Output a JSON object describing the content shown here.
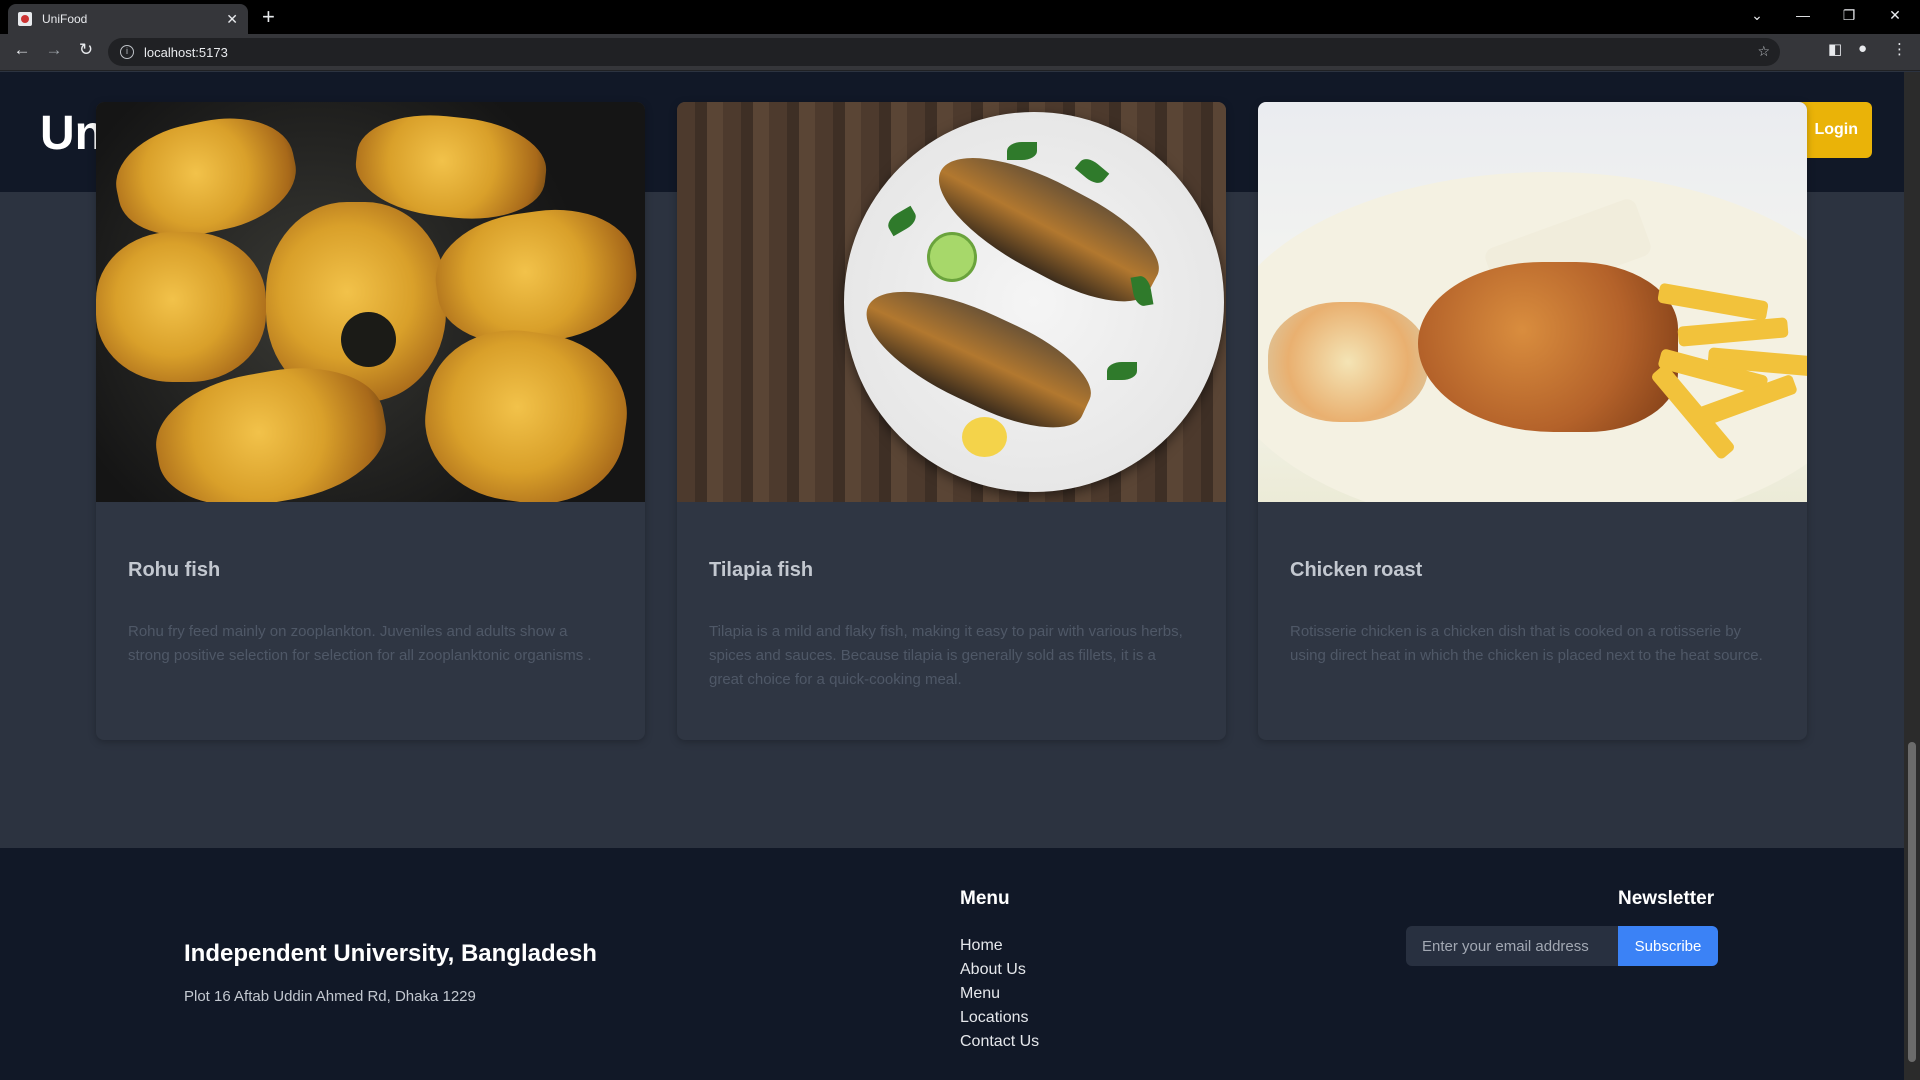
{
  "browser": {
    "tab_title": "UniFood",
    "tab_close": "✕",
    "new_tab": "+",
    "url": "localhost:5173",
    "window_controls": [
      "⌄",
      "—",
      "❐",
      "✕"
    ]
  },
  "header": {
    "brand": "Un",
    "login_label": "Login",
    "login_color": "#eab308"
  },
  "cards": [
    {
      "name": "Rohu fish",
      "description": "Rohu fry feed mainly on zooplankton. Juveniles and adults show a strong positive selection for selection for all zooplanktonic organisms ."
    },
    {
      "name": "Tilapia fish",
      "description": "Tilapia is a mild and flaky fish, making it easy to pair with various herbs, spices and sauces. Because tilapia is generally sold as fillets, it is a great choice for a quick-cooking meal."
    },
    {
      "name": "Chicken roast",
      "description": "Rotisserie chicken is a chicken dish that is cooked on a rotisserie by using direct heat in which the chicken is placed next to the heat source."
    }
  ],
  "footer": {
    "university": "Independent University, Bangladesh",
    "address": "Plot 16 Aftab Uddin Ahmed Rd, Dhaka 1229",
    "menu_title": "Menu",
    "menu_items": [
      "Home",
      "About Us",
      "Menu",
      "Locations",
      "Contact Us"
    ],
    "newsletter_title": "Newsletter",
    "email_placeholder": "Enter your email address",
    "subscribe_label": "Subscribe",
    "subscribe_color": "#3b82f6"
  }
}
